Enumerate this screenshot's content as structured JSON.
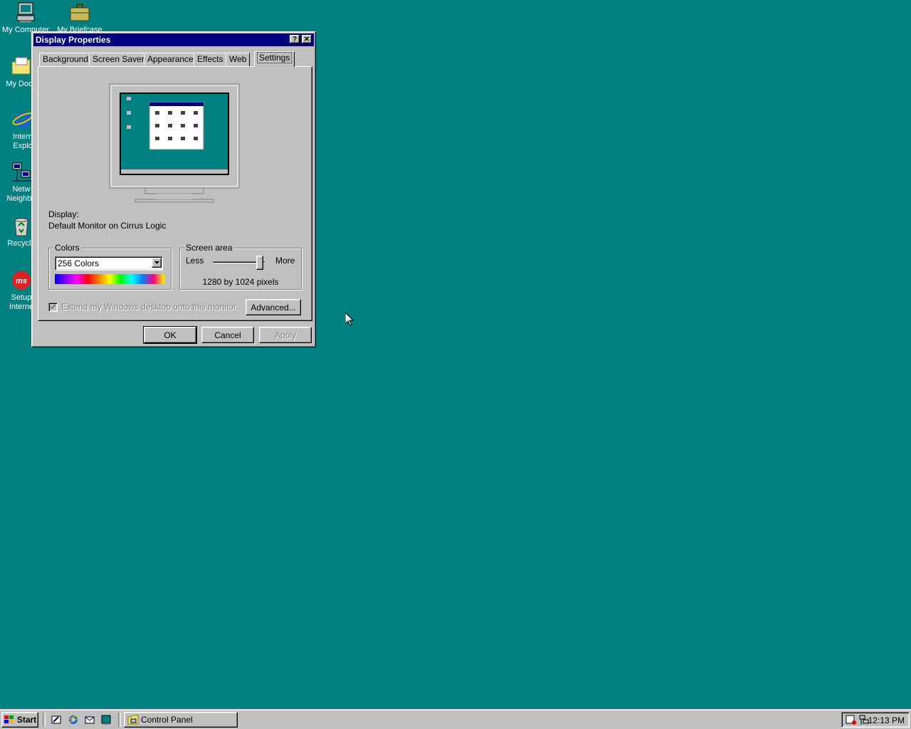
{
  "desktop": {
    "icons": [
      {
        "label": "My Computer",
        "icon": "computer-icon"
      },
      {
        "label": "My Briefcase",
        "icon": "briefcase-icon"
      },
      {
        "label": "My Docu",
        "icon": "folder-icon"
      },
      {
        "label": "Intern\nExplo",
        "icon": "ie-icon"
      },
      {
        "label": "Netw\nNeighbo",
        "icon": "network-icon"
      },
      {
        "label": "Recycle",
        "icon": "recycle-bin-icon"
      },
      {
        "label": "Setup\nInterne",
        "icon": "msn-icon"
      }
    ]
  },
  "window": {
    "title": "Display Properties",
    "help_button": "?",
    "close_button": "✕",
    "tabs": [
      "Background",
      "Screen Saver",
      "Appearance",
      "Effects",
      "Web",
      "Settings"
    ],
    "active_tab": "Settings",
    "display_label": "Display:",
    "display_value": "Default Monitor on Cirrus Logic",
    "colors": {
      "group_label": "Colors",
      "selected": "256 Colors"
    },
    "screen_area": {
      "group_label": "Screen area",
      "less": "Less",
      "more": "More",
      "value_text": "1280 by 1024 pixels",
      "slider_position": 0.95
    },
    "extend_checkbox": {
      "label": "Extend my Windows desktop onto this monitor.",
      "checked": true,
      "enabled": false
    },
    "advanced_button": "Advanced...",
    "ok_button": "OK",
    "cancel_button": "Cancel",
    "apply_button": "Apply"
  },
  "taskbar": {
    "start_label": "Start",
    "task_button": "Control Panel",
    "clock": "12:13 PM"
  },
  "colors": {
    "desktop": "#008080",
    "titlebar": "#000080",
    "face": "#c0c0c0"
  }
}
